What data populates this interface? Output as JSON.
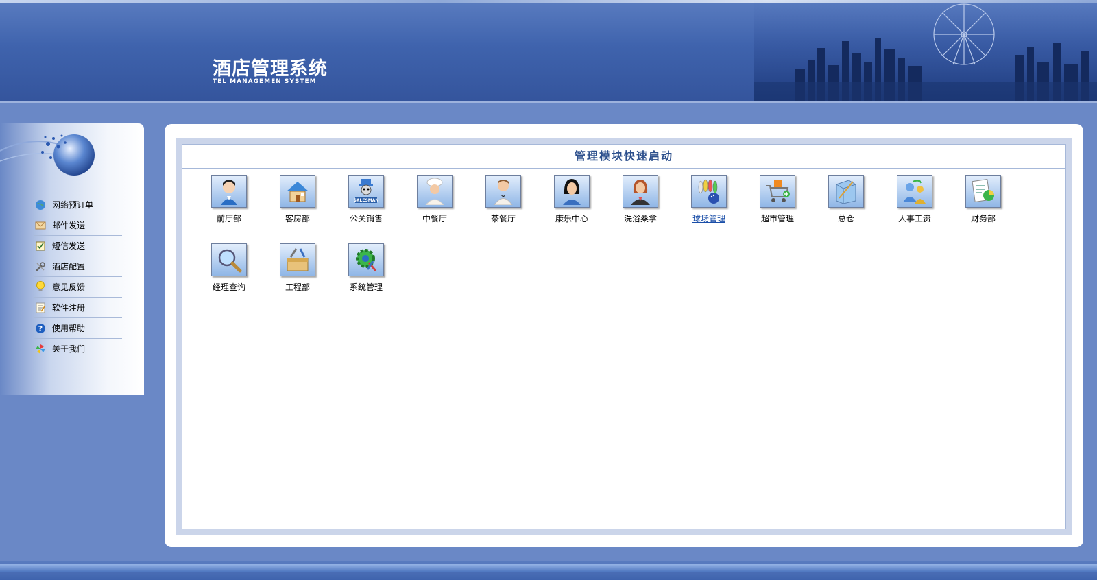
{
  "header": {
    "title_cn": "酒店管理系统",
    "title_en": "TEL MANAGEMEN SYSTEM"
  },
  "sidebar": {
    "items": [
      {
        "label": "网络预订单",
        "icon": "globe-icon"
      },
      {
        "label": "邮件发送",
        "icon": "envelope-icon"
      },
      {
        "label": "短信发送",
        "icon": "checkbox-icon"
      },
      {
        "label": "酒店配置",
        "icon": "tools-icon"
      },
      {
        "label": "意见反馈",
        "icon": "lightbulb-icon"
      },
      {
        "label": "软件注册",
        "icon": "notepad-icon"
      },
      {
        "label": "使用帮助",
        "icon": "help-icon"
      },
      {
        "label": "关于我们",
        "icon": "pinwheel-icon"
      }
    ]
  },
  "panel": {
    "title": "管理模块快速启动",
    "modules": [
      {
        "label": "前厅部",
        "icon": "receptionist-icon"
      },
      {
        "label": "客房部",
        "icon": "house-icon"
      },
      {
        "label": "公关销售",
        "icon": "salesman-icon"
      },
      {
        "label": "中餐厅",
        "icon": "chef-icon"
      },
      {
        "label": "茶餐厅",
        "icon": "waiter-icon"
      },
      {
        "label": "康乐中心",
        "icon": "woman-icon"
      },
      {
        "label": "洗浴桑拿",
        "icon": "businesswoman-icon"
      },
      {
        "label": "球场管理",
        "icon": "bowling-icon",
        "active": true
      },
      {
        "label": "超市管理",
        "icon": "shopping-cart-icon"
      },
      {
        "label": "总仓",
        "icon": "warehouse-icon"
      },
      {
        "label": "人事工资",
        "icon": "people-icon"
      },
      {
        "label": "财务部",
        "icon": "finance-chart-icon"
      },
      {
        "label": "经理查询",
        "icon": "magnifier-icon"
      },
      {
        "label": "工程部",
        "icon": "toolbox-icon"
      },
      {
        "label": "系统管理",
        "icon": "system-gear-icon"
      }
    ]
  },
  "colors": {
    "background": "#6a88c6",
    "header": "#3f63ad",
    "title_text": "#2c4f8c",
    "active_link": "#1a4ea8"
  }
}
